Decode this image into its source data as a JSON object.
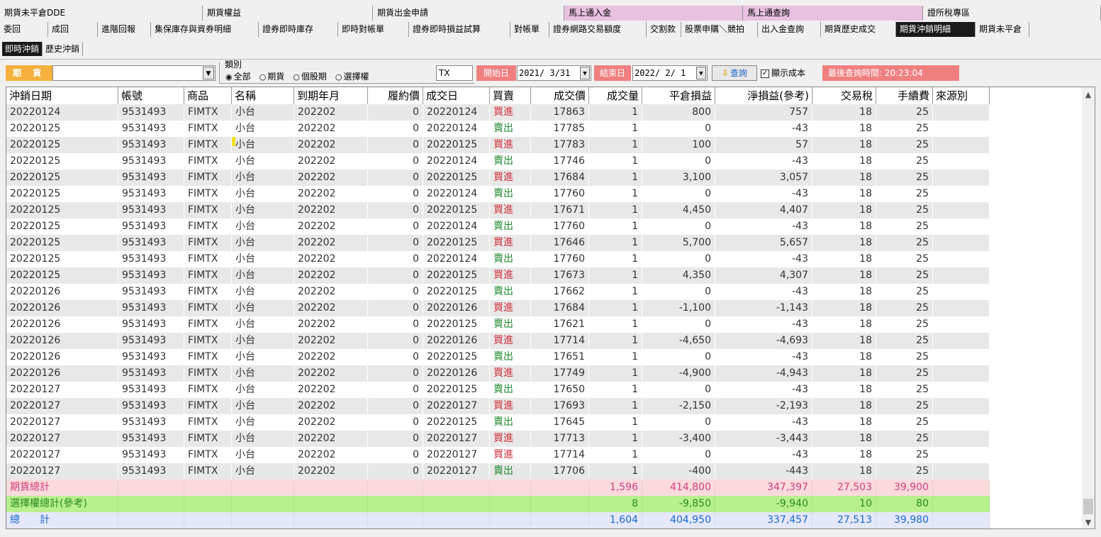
{
  "top_tabs": [
    {
      "label": "期貨未平倉DDE",
      "bg": "#f0f0f0"
    },
    {
      "label": "期貨權益",
      "bg": "#f0f0f0"
    },
    {
      "label": "期貨出金申請",
      "bg": "#f0f0f0"
    },
    {
      "label": "馬上通入金",
      "bg": "#e8c0e0"
    },
    {
      "label": "馬上通查詢",
      "bg": "#e8c0e0"
    },
    {
      "label": "證所稅專區",
      "bg": "#f0f0f0"
    }
  ],
  "main_tabs": [
    "委回",
    "成回",
    "進階回報",
    "集保庫存與資券明細",
    "證券即時庫存",
    "即時對帳單",
    "證券即時損益試算",
    "對帳單",
    "證券網路交易額度",
    "交割款",
    "股票申購＼競拍",
    "出入金查詢",
    "期貨歷史成交",
    "期貨沖銷明細",
    "期貨未平倉"
  ],
  "selected_main_tab": "期貨沖銷明細",
  "sub_tabs": [
    "即時沖銷",
    "歷史沖銷"
  ],
  "toolbar": {
    "account_label": "期 貨",
    "category_title": "類別",
    "radios": [
      "全部",
      "期貨",
      "個股期",
      "選擇權"
    ],
    "selected_radio": "全部",
    "radio_selected_glyph": "◉",
    "radio_unselected_glyph": "○",
    "product_text": "TX",
    "start_label": "開始日",
    "start_date": "2021/ 3/31",
    "end_label": "結束日",
    "end_date": "2022/ 2/ 1",
    "query_label": "查詢",
    "show_cost_label": "顯示成本",
    "show_cost_checked": true,
    "last_query_label": "最後查詢時間: 20:23:04"
  },
  "table": {
    "headers": [
      "沖銷日期",
      "帳號",
      "商品",
      "名稱",
      "到期年月",
      "履約價",
      "成交日",
      "買賣",
      "成交價",
      "成交量",
      "平倉損益",
      "淨損益(參考)",
      "交易稅",
      "手續費",
      "來源別"
    ],
    "rows": [
      [
        "20220124",
        "9531493",
        "FIMTX",
        "小台",
        "202202",
        "0",
        "20220124",
        "買進",
        "17863",
        "1",
        "800",
        "757",
        "18",
        "25",
        ""
      ],
      [
        "20220125",
        "9531493",
        "FIMTX",
        "小台",
        "202202",
        "0",
        "20220124",
        "賣出",
        "17785",
        "1",
        "0",
        "-43",
        "18",
        "25",
        ""
      ],
      [
        "20220125",
        "9531493",
        "FIMTX",
        "小台",
        "202202",
        "0",
        "20220125",
        "買進",
        "17783",
        "1",
        "100",
        "57",
        "18",
        "25",
        ""
      ],
      [
        "20220125",
        "9531493",
        "FIMTX",
        "小台",
        "202202",
        "0",
        "20220124",
        "賣出",
        "17746",
        "1",
        "0",
        "-43",
        "18",
        "25",
        ""
      ],
      [
        "20220125",
        "9531493",
        "FIMTX",
        "小台",
        "202202",
        "0",
        "20220125",
        "買進",
        "17684",
        "1",
        "3,100",
        "3,057",
        "18",
        "25",
        ""
      ],
      [
        "20220125",
        "9531493",
        "FIMTX",
        "小台",
        "202202",
        "0",
        "20220124",
        "賣出",
        "17760",
        "1",
        "0",
        "-43",
        "18",
        "25",
        ""
      ],
      [
        "20220125",
        "9531493",
        "FIMTX",
        "小台",
        "202202",
        "0",
        "20220125",
        "買進",
        "17671",
        "1",
        "4,450",
        "4,407",
        "18",
        "25",
        ""
      ],
      [
        "20220125",
        "9531493",
        "FIMTX",
        "小台",
        "202202",
        "0",
        "20220124",
        "賣出",
        "17760",
        "1",
        "0",
        "-43",
        "18",
        "25",
        ""
      ],
      [
        "20220125",
        "9531493",
        "FIMTX",
        "小台",
        "202202",
        "0",
        "20220125",
        "買進",
        "17646",
        "1",
        "5,700",
        "5,657",
        "18",
        "25",
        ""
      ],
      [
        "20220125",
        "9531493",
        "FIMTX",
        "小台",
        "202202",
        "0",
        "20220124",
        "賣出",
        "17760",
        "1",
        "0",
        "-43",
        "18",
        "25",
        ""
      ],
      [
        "20220125",
        "9531493",
        "FIMTX",
        "小台",
        "202202",
        "0",
        "20220125",
        "買進",
        "17673",
        "1",
        "4,350",
        "4,307",
        "18",
        "25",
        ""
      ],
      [
        "20220126",
        "9531493",
        "FIMTX",
        "小台",
        "202202",
        "0",
        "20220125",
        "賣出",
        "17662",
        "1",
        "0",
        "-43",
        "18",
        "25",
        ""
      ],
      [
        "20220126",
        "9531493",
        "FIMTX",
        "小台",
        "202202",
        "0",
        "20220126",
        "買進",
        "17684",
        "1",
        "-1,100",
        "-1,143",
        "18",
        "25",
        ""
      ],
      [
        "20220126",
        "9531493",
        "FIMTX",
        "小台",
        "202202",
        "0",
        "20220125",
        "賣出",
        "17621",
        "1",
        "0",
        "-43",
        "18",
        "25",
        ""
      ],
      [
        "20220126",
        "9531493",
        "FIMTX",
        "小台",
        "202202",
        "0",
        "20220126",
        "買進",
        "17714",
        "1",
        "-4,650",
        "-4,693",
        "18",
        "25",
        ""
      ],
      [
        "20220126",
        "9531493",
        "FIMTX",
        "小台",
        "202202",
        "0",
        "20220125",
        "賣出",
        "17651",
        "1",
        "0",
        "-43",
        "18",
        "25",
        ""
      ],
      [
        "20220126",
        "9531493",
        "FIMTX",
        "小台",
        "202202",
        "0",
        "20220126",
        "買進",
        "17749",
        "1",
        "-4,900",
        "-4,943",
        "18",
        "25",
        ""
      ],
      [
        "20220127",
        "9531493",
        "FIMTX",
        "小台",
        "202202",
        "0",
        "20220125",
        "賣出",
        "17650",
        "1",
        "0",
        "-43",
        "18",
        "25",
        ""
      ],
      [
        "20220127",
        "9531493",
        "FIMTX",
        "小台",
        "202202",
        "0",
        "20220127",
        "買進",
        "17693",
        "1",
        "-2,150",
        "-2,193",
        "18",
        "25",
        ""
      ],
      [
        "20220127",
        "9531493",
        "FIMTX",
        "小台",
        "202202",
        "0",
        "20220125",
        "賣出",
        "17645",
        "1",
        "0",
        "-43",
        "18",
        "25",
        ""
      ],
      [
        "20220127",
        "9531493",
        "FIMTX",
        "小台",
        "202202",
        "0",
        "20220127",
        "買進",
        "17713",
        "1",
        "-3,400",
        "-3,443",
        "18",
        "25",
        ""
      ],
      [
        "20220127",
        "9531493",
        "FIMTX",
        "小台",
        "202202",
        "0",
        "20220127",
        "買進",
        "17714",
        "1",
        "0",
        "-43",
        "18",
        "25",
        ""
      ],
      [
        "20220127",
        "9531493",
        "FIMTX",
        "小台",
        "202202",
        "0",
        "20220127",
        "賣出",
        "17706",
        "1",
        "-400",
        "-443",
        "18",
        "25",
        ""
      ]
    ],
    "summary": [
      {
        "kind": "fut",
        "label": "期貨總計",
        "qty": "1,596",
        "pl": "414,800",
        "net": "347,397",
        "tax": "27,503",
        "fee": "39,900"
      },
      {
        "kind": "opt",
        "label": "選擇權總計(參考)",
        "qty": "8",
        "pl": "-9,850",
        "net": "-9,940",
        "tax": "10",
        "fee": "80"
      },
      {
        "kind": "tot",
        "label": "總　　計",
        "qty": "1,604",
        "pl": "404,950",
        "net": "337,457",
        "tax": "27,513",
        "fee": "39,980"
      }
    ]
  },
  "icons": {
    "scroll_up": "▲",
    "scroll_down": "▼",
    "dropdown": "▼",
    "query": "⇩",
    "check": "✓"
  },
  "colors": {
    "buy": "#d0303a",
    "sell": "#1e8a2e",
    "accent": "#f08080",
    "account": "#f5b03d"
  }
}
